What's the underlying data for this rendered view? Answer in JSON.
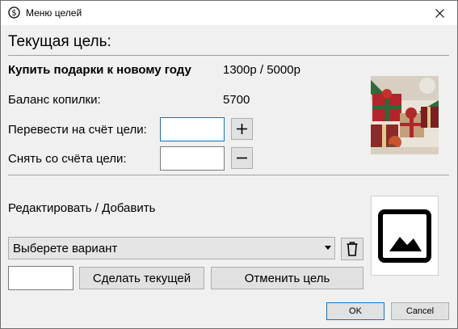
{
  "window": {
    "title": "Меню целей"
  },
  "current_goal": {
    "heading": "Текущая цель:",
    "name": "Купить подарки к новому году",
    "progress": "1300р / 5000р"
  },
  "balance": {
    "label": "Баланс копилки:",
    "value": "5700"
  },
  "transfer": {
    "label": "Перевести на счёт цели:",
    "value": ""
  },
  "withdraw": {
    "label": "Снять со счёта цели:",
    "value": ""
  },
  "edit": {
    "heading": "Редактировать / Добавить",
    "select_value": "Выберете вариант",
    "name_value": "",
    "make_current_label": "Сделать текущей",
    "cancel_goal_label": "Отменить цель"
  },
  "footer": {
    "ok_label": "OK",
    "cancel_label": "Cancel"
  },
  "colors": {
    "window_bg": "#f0f0f0",
    "accent": "#0078d7",
    "button_bg": "#e1e1e1"
  }
}
